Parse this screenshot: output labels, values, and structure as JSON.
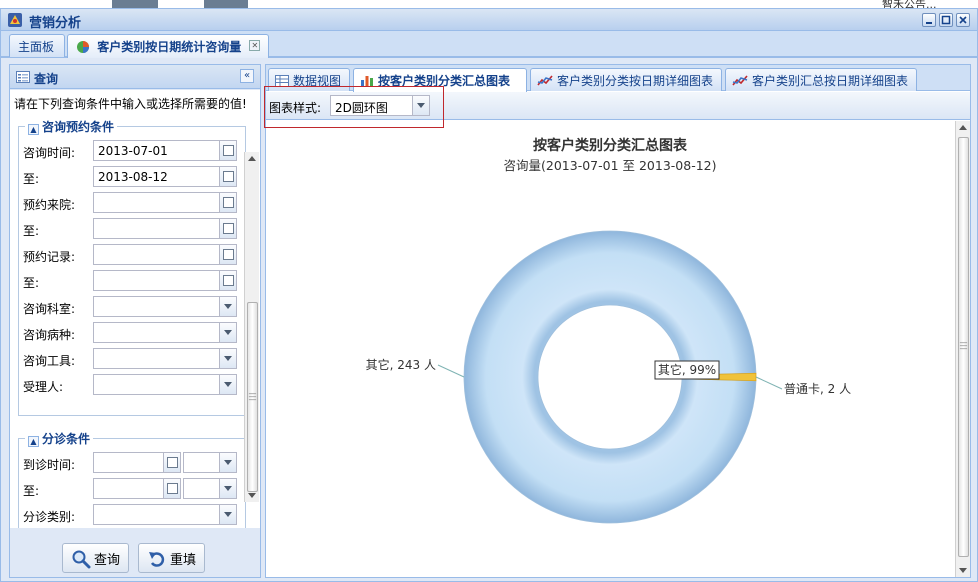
{
  "top_note": "智禾公告...",
  "window": {
    "title": "营销分析"
  },
  "top_tabs": [
    {
      "label": "主面板"
    },
    {
      "label": "客户类别按日期统计咨询量",
      "closable": true
    }
  ],
  "query_panel": {
    "title": "查询",
    "prompt": "请在下列查询条件中输入或选择所需要的值!",
    "consult_section": {
      "legend": "咨询预约条件",
      "fields": [
        {
          "label": "咨询时间:",
          "value": ""
        },
        {
          "label": "至:",
          "value": ""
        },
        {
          "label": "预约来院:",
          "value": ""
        },
        {
          "label": "至:",
          "value": ""
        },
        {
          "label": "预约记录:",
          "value": ""
        },
        {
          "label": "至:",
          "value": ""
        },
        {
          "label": "咨询科室:",
          "value": ""
        },
        {
          "label": "咨询病种:",
          "value": ""
        },
        {
          "label": "咨询工具:",
          "value": ""
        },
        {
          "label": "受理人:",
          "value": ""
        }
      ],
      "consult_start": "2013-07-01",
      "consult_end": "2013-08-12"
    },
    "triage_section": {
      "legend": "分诊条件",
      "fields": [
        {
          "label": "到诊时间:"
        },
        {
          "label": "至:"
        },
        {
          "label": "分诊类别:"
        }
      ]
    },
    "buttons": {
      "query": "查询",
      "reset": "重填"
    }
  },
  "chart_tabs": [
    {
      "label": "数据视图"
    },
    {
      "label": "按客户类别分类汇总图表",
      "active": true
    },
    {
      "label": "客户类别分类按日期详细图表"
    },
    {
      "label": "客户类别汇总按日期详细图表"
    }
  ],
  "toolbar": {
    "style_label": "图表样式:",
    "style_value": "2D圆环图"
  },
  "colors": {
    "ring": "#c3dff5",
    "highlight": "#f0c23a",
    "red_box": "#c0282d"
  },
  "chart_data": {
    "type": "pie",
    "variant": "doughnut",
    "title": "按客户类别分类汇总图表",
    "subtitle": "咨询量(2013-07-01 至 2013-08-12)",
    "slices": [
      {
        "label": "其它",
        "value": 243,
        "unit": "人",
        "data_label": "其它, 243 人",
        "color": "#c3dff5"
      },
      {
        "label": "普通卡",
        "value": 2,
        "unit": "人",
        "data_label": "普通卡, 2 人",
        "color": "#f0c23a"
      }
    ],
    "tooltip": "其它, 99%"
  }
}
